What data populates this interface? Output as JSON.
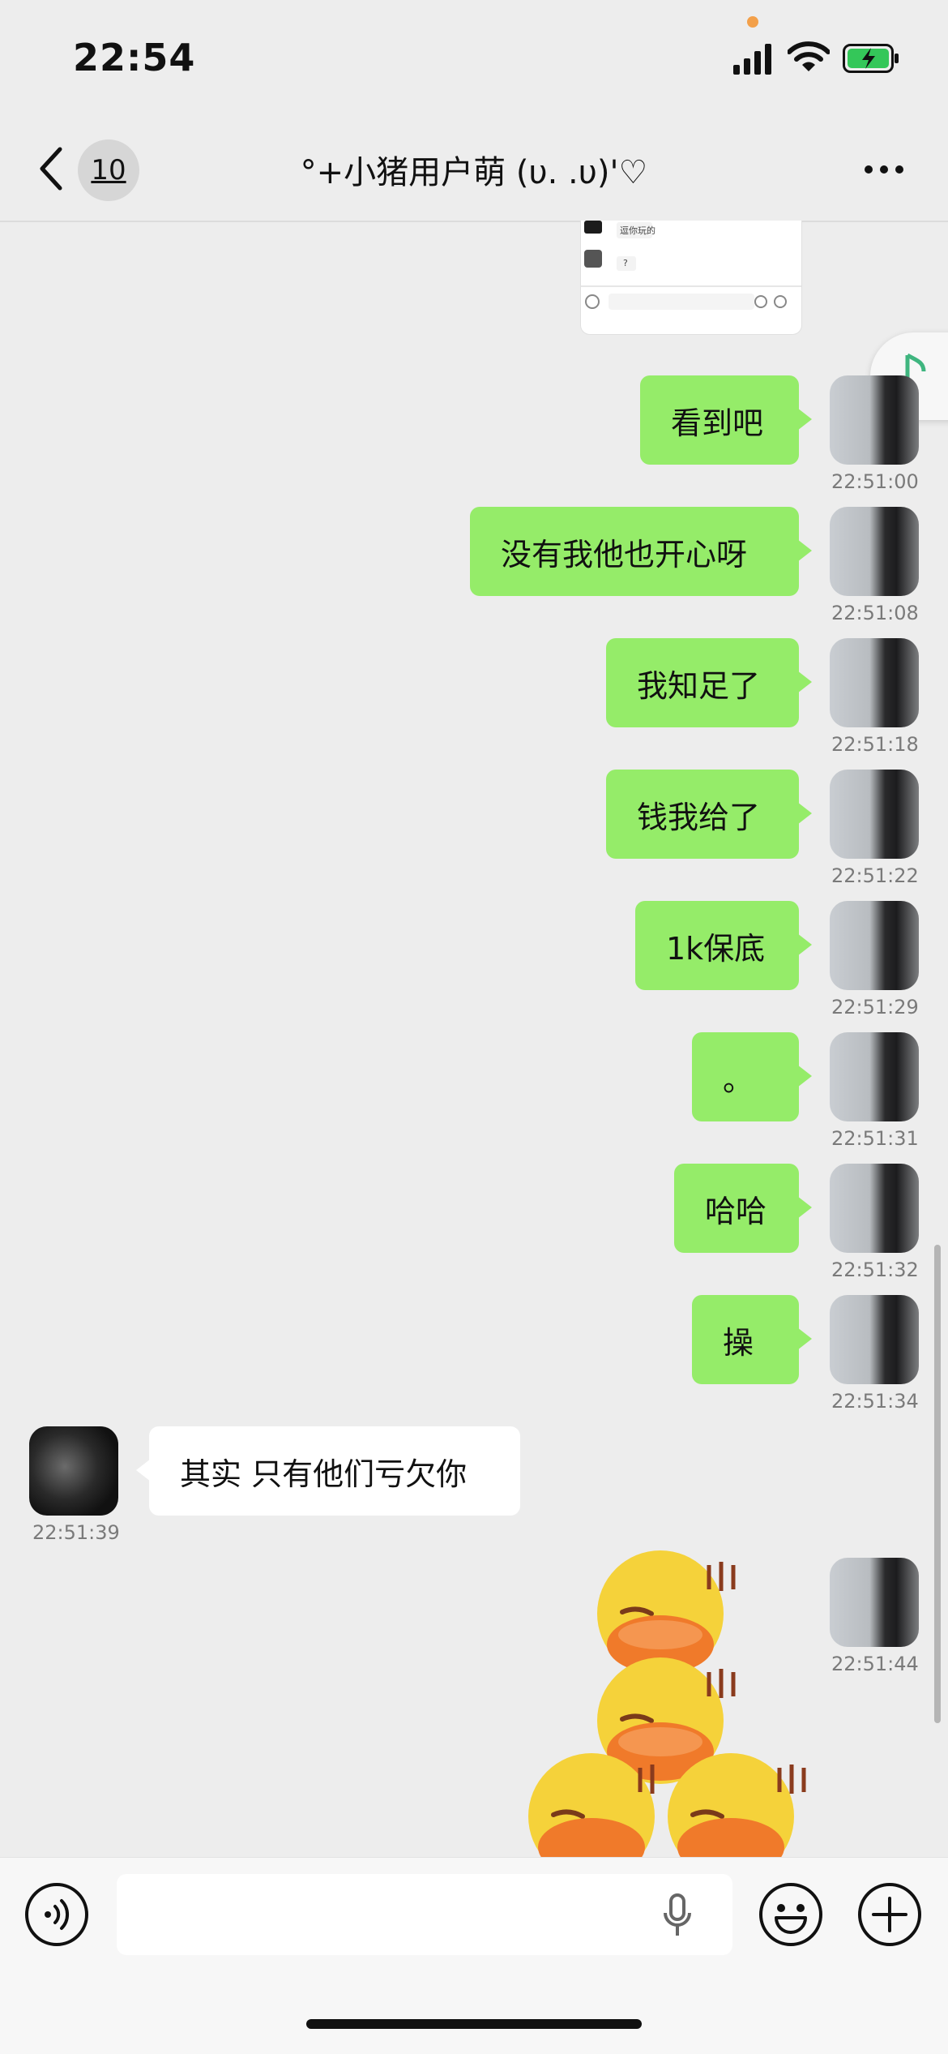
{
  "status_bar": {
    "time": "22:54"
  },
  "nav": {
    "unread_count": "10",
    "title": "°+小猪用户萌 (υ. .υ)'♡"
  },
  "thumbnail": {
    "message_1": "逗你玩的",
    "message_2": "?"
  },
  "messages": [
    {
      "side": "me",
      "text": "看到吧",
      "time": "22:51:00"
    },
    {
      "side": "me",
      "text": "没有我他也开心呀",
      "time": "22:51:08"
    },
    {
      "side": "me",
      "text": "我知足了",
      "time": "22:51:18"
    },
    {
      "side": "me",
      "text": "钱我给了",
      "time": "22:51:22"
    },
    {
      "side": "me",
      "text": "1k保底",
      "time": "22:51:29"
    },
    {
      "side": "me",
      "text": "。",
      "time": "22:51:31"
    },
    {
      "side": "me",
      "text": "哈哈",
      "time": "22:51:32"
    },
    {
      "side": "me",
      "text": "操",
      "time": "22:51:34"
    },
    {
      "side": "other",
      "text": "其实 只有他们亏欠你",
      "time": "22:51:39"
    },
    {
      "side": "me",
      "sticker": "duck-sticker",
      "time": "22:51:44"
    }
  ],
  "colors": {
    "background": "#ededed",
    "bubble_me": "#95ec69",
    "bubble_other": "#ffffff",
    "accent_green": "#07c160"
  }
}
